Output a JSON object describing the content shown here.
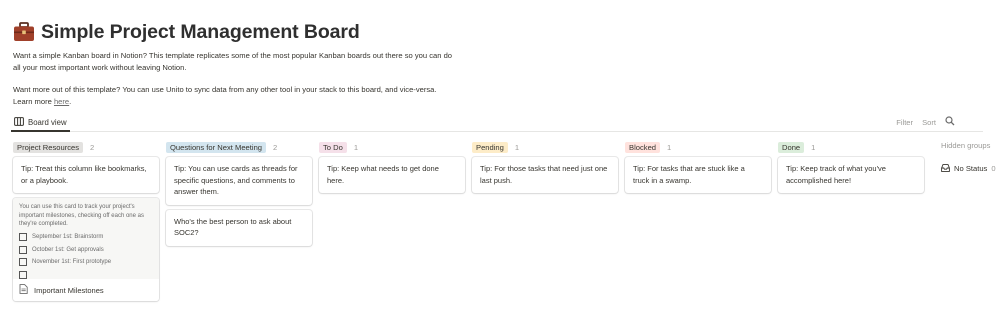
{
  "page": {
    "title": "Simple Project Management Board",
    "description_1": "Want a simple Kanban board in Notion? This template replicates some of the most popular Kanban boards out there so you can do all your most important work without leaving Notion.",
    "description_2_prefix": "Want more out of this template? You can use Unito to sync data from any other tool in your stack to this board, and vice-versa. Learn more ",
    "description_2_link": "here",
    "description_2_suffix": ".",
    "icon": "briefcase-icon"
  },
  "toolbar": {
    "view_label": "Board view",
    "filter_label": "Filter",
    "sort_label": "Sort",
    "search_icon": "search-icon"
  },
  "columns": [
    {
      "name": "Project Resources",
      "count": "2",
      "color": "#e3e2e0",
      "cards": [
        "Tip: Treat this column like bookmarks, or a playbook."
      ],
      "milestone": {
        "preview_text": "You can use this card to track your project's important milestones, checking off each one as they're completed.",
        "todos": [
          "September 1st: Brainstorm",
          "October 1st: Get approvals",
          "November 1st: First prototype"
        ],
        "title": "Important Milestones"
      }
    },
    {
      "name": "Questions for Next Meeting",
      "count": "2",
      "color": "#d3e5ef",
      "cards": [
        "Tip: You can use cards as threads for specific questions, and comments to answer them.",
        "Who's the best person to ask about SOC2?"
      ]
    },
    {
      "name": "To Do",
      "count": "1",
      "color": "#f5e0e9",
      "cards": [
        "Tip: Keep what needs to get done here."
      ]
    },
    {
      "name": "Pending",
      "count": "1",
      "color": "#fdecc8",
      "cards": [
        "Tip: For those tasks that need just one last push."
      ]
    },
    {
      "name": "Blocked",
      "count": "1",
      "color": "#ffe2dd",
      "cards": [
        "Tip: For tasks that are stuck like a truck in a swamp."
      ]
    },
    {
      "name": "Done",
      "count": "1",
      "color": "#dbeddb",
      "cards": [
        "Tip: Keep track of what you've accomplished here!"
      ]
    }
  ],
  "hidden_groups": {
    "title": "Hidden groups",
    "items": [
      "No Status"
    ],
    "item_count": "0"
  }
}
